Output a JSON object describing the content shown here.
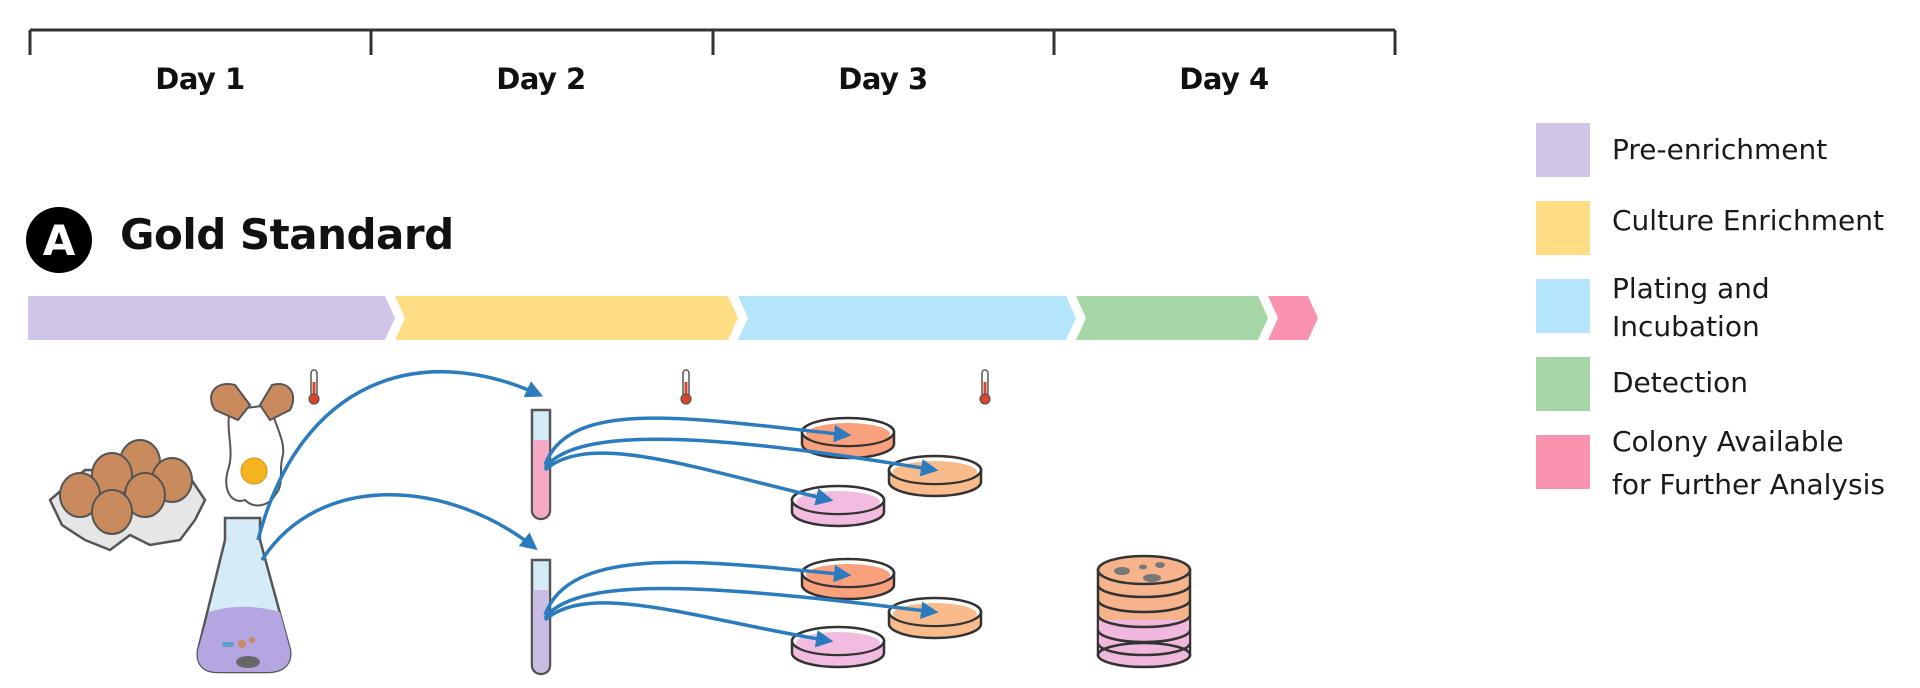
{
  "timeline": {
    "days": [
      "Day 1",
      "Day 2",
      "Day 3",
      "Day 4"
    ]
  },
  "panel": {
    "badge": "A",
    "title": "Gold Standard"
  },
  "stages": [
    {
      "name": "Pre-enrichment",
      "color": "#d0c5e9"
    },
    {
      "name": "Culture Enrichment",
      "color": "#ffdd85"
    },
    {
      "name": "Plating and Incubation",
      "color": "#b4e5fa"
    },
    {
      "name": "Detection",
      "color": "#a6d6a6"
    },
    {
      "name": "Colony Available for Further Analysis",
      "color": "#f993b0"
    }
  ],
  "legend": [
    {
      "lines": [
        "Pre-enrichment"
      ],
      "color": "#d0c5e9"
    },
    {
      "lines": [
        "Culture Enrichment"
      ],
      "color": "#ffdd85"
    },
    {
      "lines": [
        "Plating and",
        "Incubation"
      ],
      "color": "#b4e5fa"
    },
    {
      "lines": [
        "Detection"
      ],
      "color": "#a6d6a6"
    },
    {
      "lines": [
        "Colony Available",
        "for Further Analysis"
      ],
      "color": "#f993b0"
    }
  ],
  "icons": {
    "egg_carton": "egg-carton-icon",
    "cracked_egg": "cracked-egg-icon",
    "flask": "erlenmeyer-flask-icon",
    "test_tube": "test-tube-icon",
    "petri_dish": "petri-dish-icon",
    "thermometer": "thermometer-icon",
    "plate_stack": "plate-stack-icon"
  },
  "colors": {
    "arrow": "#2b7bbf",
    "timeline_line": "#333333"
  }
}
